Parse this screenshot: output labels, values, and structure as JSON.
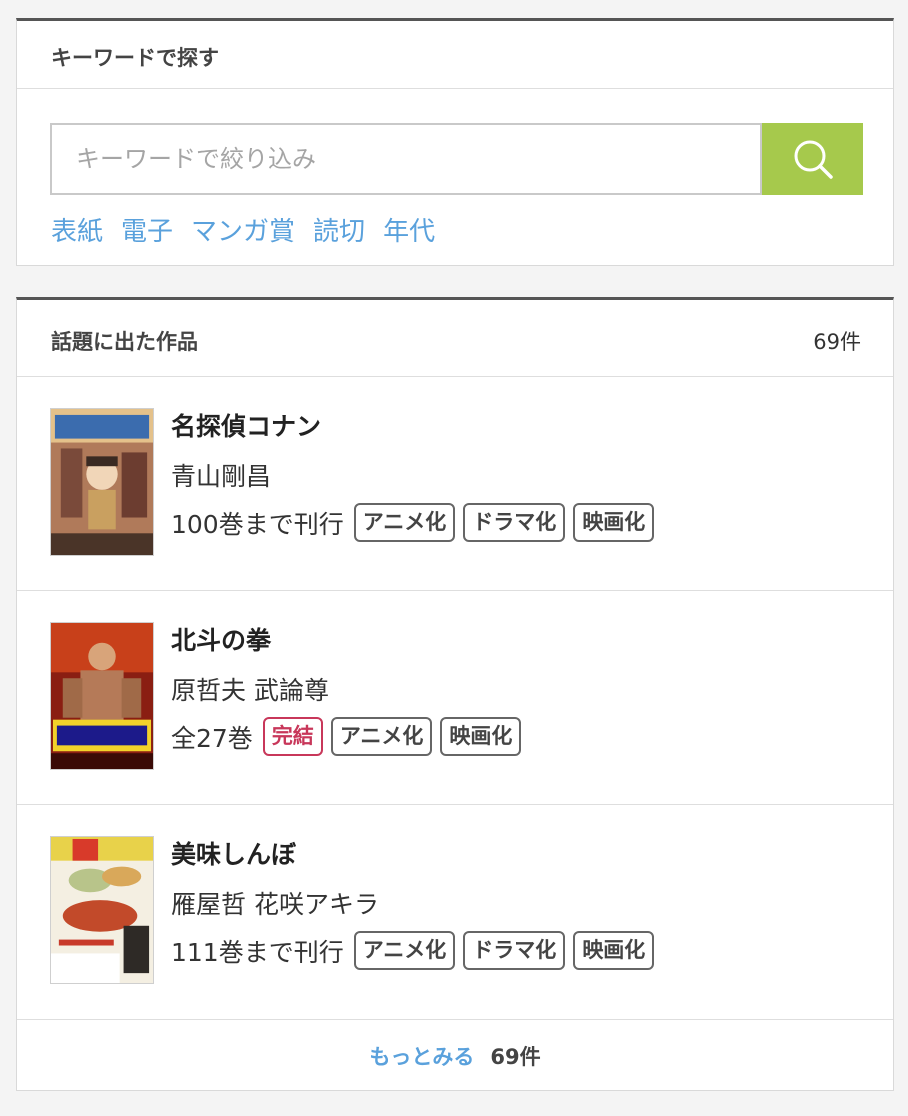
{
  "search": {
    "title": "キーワードで探す",
    "placeholder": "キーワードで絞り込み",
    "button_icon": "search-icon",
    "button_color": "#a6c94c",
    "links": [
      "表紙",
      "電子",
      "マンガ賞",
      "読切",
      "年代"
    ]
  },
  "works": {
    "title": "話題に出た作品",
    "count": "69件",
    "items": [
      {
        "title": "名探偵コナン",
        "author": "青山剛昌",
        "volume": "100巻まで刊行",
        "tags": [
          "アニメ化",
          "ドラマ化",
          "映画化"
        ]
      },
      {
        "title": "北斗の拳",
        "author": "原哲夫 武論尊",
        "volume": "全27巻",
        "completed_tag": "完結",
        "tags": [
          "アニメ化",
          "映画化"
        ]
      },
      {
        "title": "美味しんぼ",
        "author": "雁屋哲 花咲アキラ",
        "volume": "111巻まで刊行",
        "tags": [
          "アニメ化",
          "ドラマ化",
          "映画化"
        ]
      }
    ],
    "more_label": "もっとみる",
    "more_count": "69件"
  },
  "colors": {
    "link": "#5aa1dc",
    "completed": "#c8375a"
  }
}
